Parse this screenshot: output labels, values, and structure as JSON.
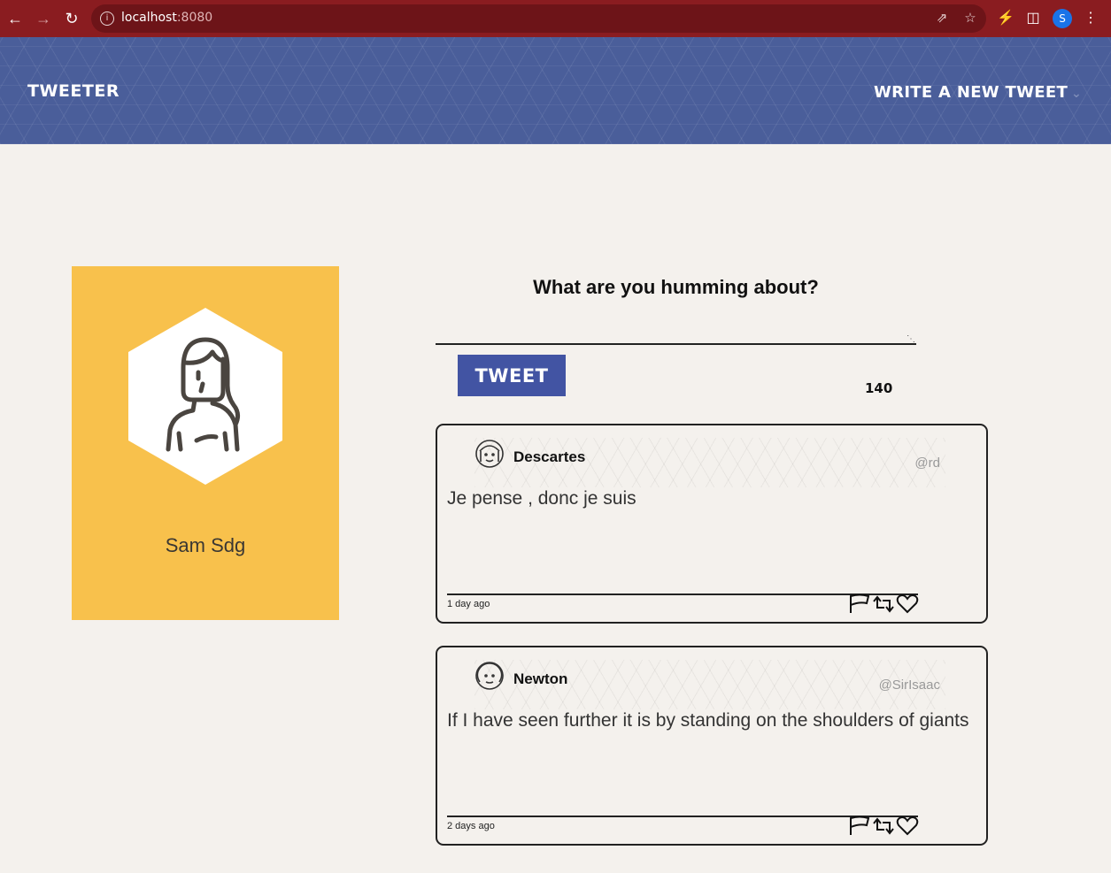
{
  "browser": {
    "url_host": "localhost",
    "url_port": ":8080",
    "profile_initial": "S"
  },
  "header": {
    "brand": "TWEETER",
    "write_link": "WRITE A NEW TWEET",
    "bg_color": "#4a5e9a"
  },
  "profile": {
    "name": "Sam Sdg",
    "card_color": "#f8c14c"
  },
  "compose": {
    "title": "What are you humming about?",
    "input_value": "",
    "button_label": "TWEET",
    "counter": "140",
    "button_color": "#4254a3"
  },
  "tweets": [
    {
      "name": "Descartes",
      "handle": "@rd",
      "body": "Je pense , donc je suis",
      "time": "1 day ago"
    },
    {
      "name": "Newton",
      "handle": "@SirIsaac",
      "body": "If I have seen further it is by standing on the shoulders of giants",
      "time": "2 days ago"
    }
  ]
}
